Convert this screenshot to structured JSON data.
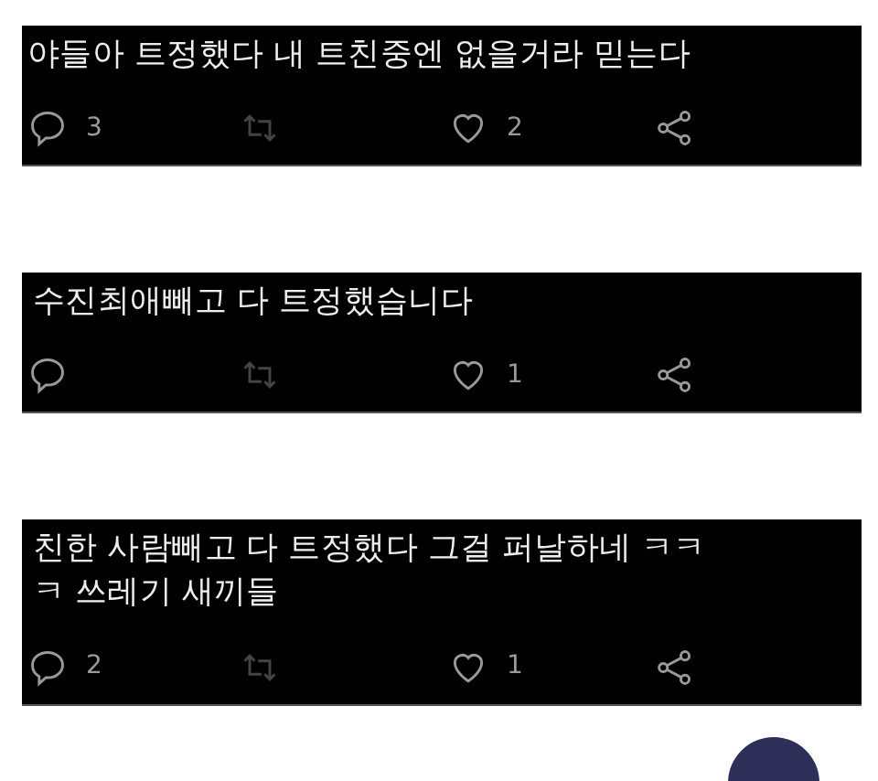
{
  "tweets": [
    {
      "text": "야들아 트정했다 내 트친중엔 없을거라 믿는다",
      "reply_count": "3",
      "like_count": "2"
    },
    {
      "text": "수진최애빼고 다 트정했습니다",
      "like_count": "1"
    },
    {
      "text": "친한 사람빼고 다 트정했다 그걸 퍼날하네 ㅋㅋㅋ 쓰레기 새끼들",
      "reply_count": "2",
      "like_count": "1"
    }
  ]
}
